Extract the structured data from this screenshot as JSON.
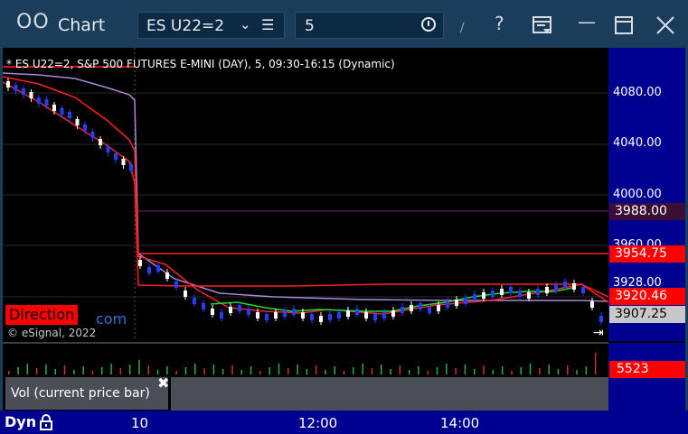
{
  "window": {
    "logo": "OO",
    "title": "Chart"
  },
  "toolbar": {
    "symbol": "ES U22=2",
    "interval": "5"
  },
  "chart": {
    "header": "* ES U22=2, S&P 500 FUTURES E-MINI (DAY), 5, 09:30-16:15 (Dynamic)",
    "copyright": "© eSignal, 2022",
    "direction_label": "Direction",
    "direction_suffix": "com",
    "price_ticks": [
      "4080.00",
      "4040.00",
      "4000.00",
      "3960.00",
      "3928.00"
    ],
    "price_labels": [
      {
        "value": "3988.00",
        "color": "#3a0e35",
        "text_color": "#ffffff"
      },
      {
        "value": "3954.75",
        "color": "#ff0000",
        "text_color": "#ffffff"
      },
      {
        "value": "3920.46",
        "color": "#ff0000",
        "text_color": "#ffffff"
      },
      {
        "value": "3907.25",
        "color": "#c8c8c8",
        "text_color": "#000000"
      }
    ]
  },
  "volume": {
    "legend": "Vol (current price bar)",
    "value": "5523"
  },
  "bottombar": {
    "mode": "Dyn",
    "time_labels": [
      "10",
      "12:00",
      "14:00"
    ]
  },
  "colors": {
    "bull_candle": "#ffffff",
    "bear_candle": "#2040ff",
    "ma_red": "#ff2020",
    "ma_purple": "#a888d8",
    "ma_green": "#20e020",
    "scale_bg": "#000090",
    "chart_bg": "#000000",
    "frame_bg": "#1b3d5c"
  },
  "icons": {
    "symbol_list": "list-icon",
    "interval_clock": "clock-icon",
    "help": "question-icon",
    "layout": "layout-icon",
    "maximize": "maximize-icon",
    "close": "close-icon",
    "lock": "lock-icon",
    "goto_end": "goto-end-icon"
  }
}
